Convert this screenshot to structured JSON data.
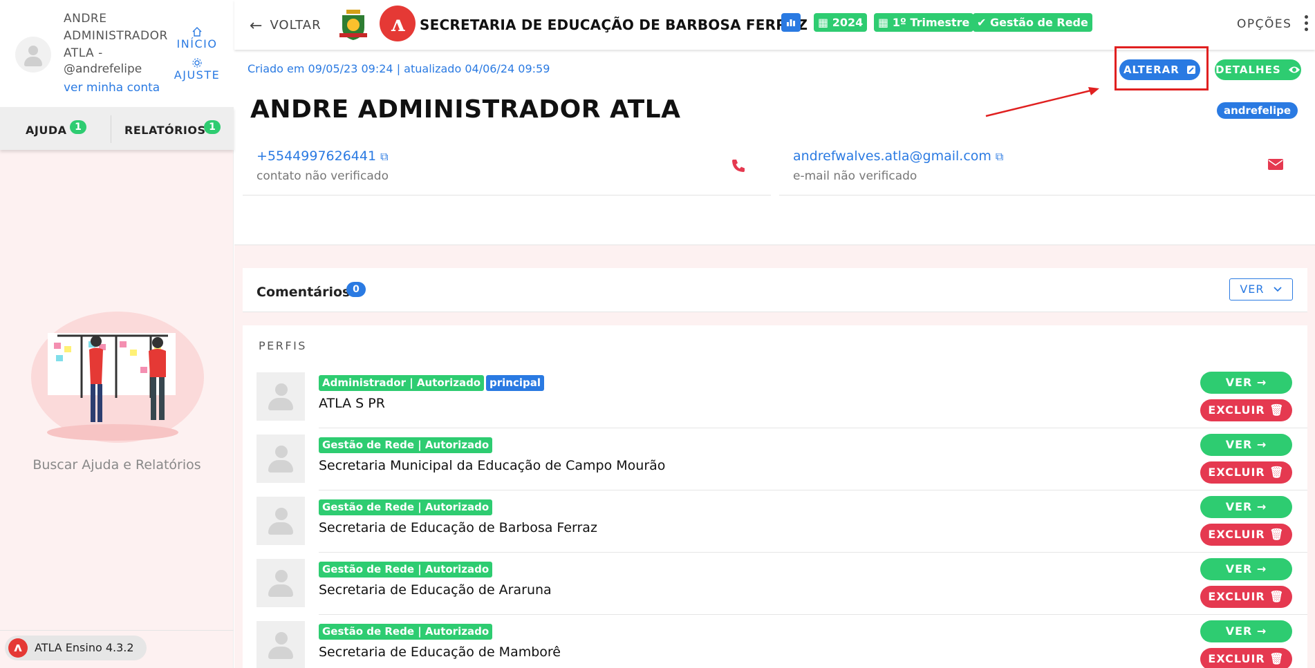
{
  "user": {
    "name": "ANDRE ADMINISTRADOR ATLA -",
    "handle": "@andrefelipe",
    "my_account": "ver minha conta",
    "home_label": "INÍCIO",
    "settings_label": "AJUSTE"
  },
  "sidebar": {
    "tabs": [
      {
        "label": "AJUDA",
        "count": "1"
      },
      {
        "label": "RELATÓRIOS",
        "count": "1"
      }
    ],
    "help_text": "Buscar Ajuda e Relatórios",
    "version": "ATLA Ensino 4.3.2"
  },
  "header": {
    "back_label": "VOLTAR",
    "title": "SECRETARIA DE EDUCAÇÃO DE BARBOSA FERRAZ",
    "chip_year": "2024",
    "chip_trimester": "1º Trimestre",
    "chip_network": "Gestão de Rede",
    "options_label": "OPÇÕES"
  },
  "profile": {
    "meta": "Criado em 09/05/23 09:24 | atualizado 04/06/24 09:59",
    "alterar_label": "ALTERAR",
    "detalhes_label": "DETALHES",
    "name": "ANDRE ADMINISTRADOR ATLA",
    "username_tag": "andrefelipe",
    "phone": "+5544997626441",
    "phone_status": "contato não verificado",
    "email": "andrefwalves.atla@gmail.com",
    "email_status": "e-mail não verificado"
  },
  "comments": {
    "label": "Comentários",
    "count": "0",
    "ver_label": "VER"
  },
  "perfis": {
    "title": "PERFIS",
    "ver_label": "VER",
    "excluir_label": "EXCLUIR",
    "rows": [
      {
        "role": "Administrador | Autorizado",
        "tag": "principal",
        "org": "ATLA S PR"
      },
      {
        "role": "Gestão de Rede | Autorizado",
        "org": "Secretaria Municipal da Educação de Campo Mourão"
      },
      {
        "role": "Gestão de Rede | Autorizado",
        "org": "Secretaria de Educação de Barbosa Ferraz"
      },
      {
        "role": "Gestão de Rede | Autorizado",
        "org": "Secretaria de Educação de Araruna"
      },
      {
        "role": "Gestão de Rede | Autorizado",
        "org": "Secretaria de Educação de Mamborê"
      }
    ]
  },
  "colors": {
    "accent_blue": "#2a7ae2",
    "accent_green": "#2ecc71",
    "accent_red": "#e53950",
    "annotation_red": "#e02020"
  }
}
